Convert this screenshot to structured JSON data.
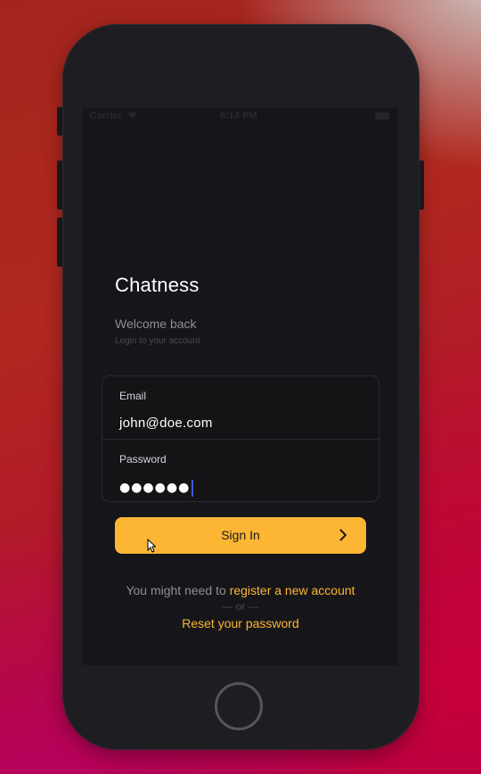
{
  "status_bar": {
    "carrier": "Carrier",
    "time": "6:14 PM"
  },
  "header": {
    "title": "Chatness",
    "welcome": "Welcome back",
    "subtitle": "Login to your account"
  },
  "form": {
    "email_label": "Email",
    "email_value": "john@doe.com",
    "password_label": "Password",
    "password_mask": "●●●●●●"
  },
  "sign_in_button": {
    "label": "Sign In",
    "icon": "chevron-right-icon"
  },
  "footer": {
    "register_prefix": "You might need to ",
    "register_link": "register a new account",
    "or_divider": "— or —",
    "reset_link": "Reset your password"
  },
  "colors": {
    "accent": "#fcb633",
    "screen_background": "#16161a",
    "caret": "#3f5bd8"
  }
}
